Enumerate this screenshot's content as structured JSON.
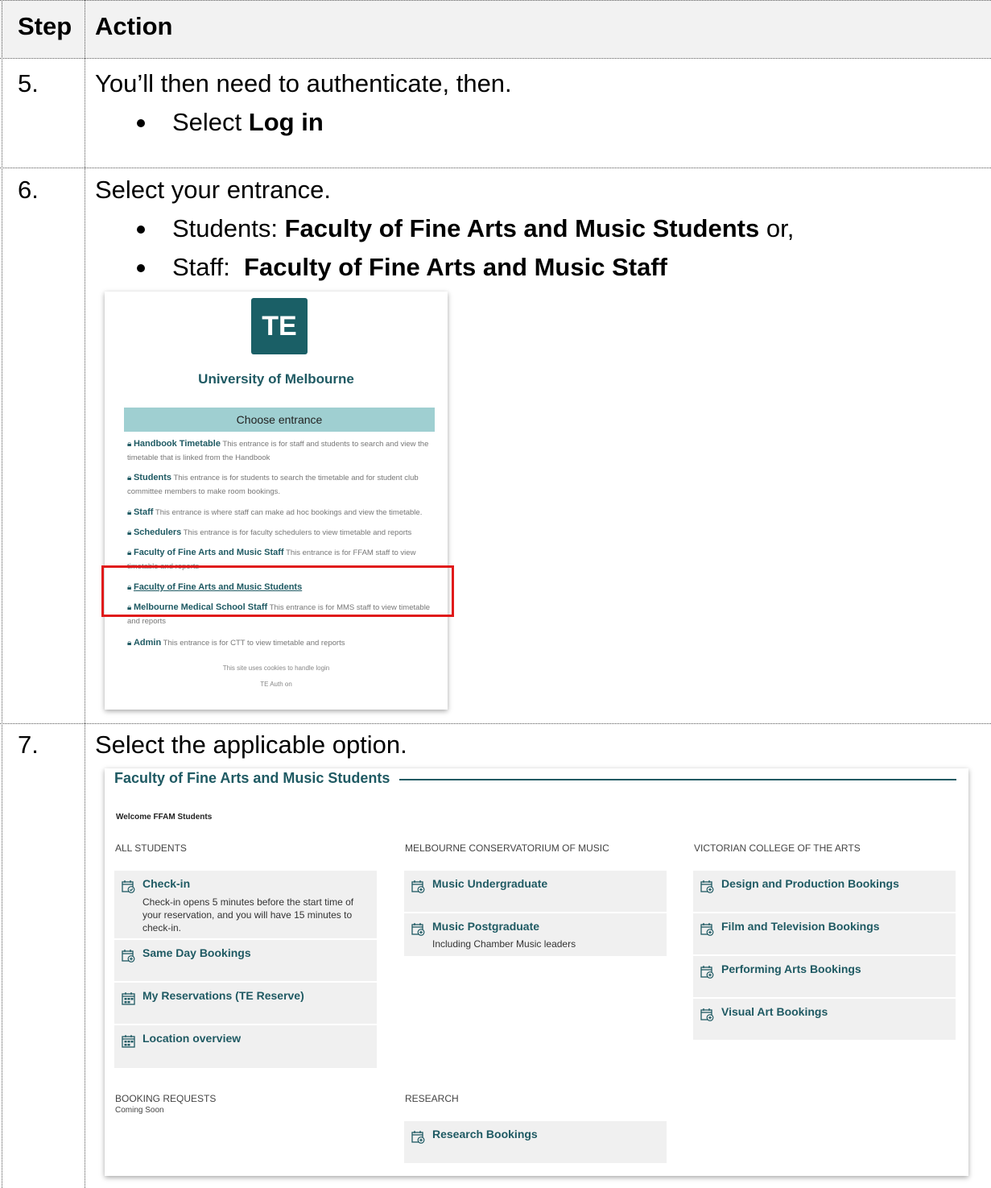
{
  "header": {
    "step": "Step",
    "action": "Action"
  },
  "rows": [
    {
      "num": "5.",
      "text": "You’ll then need to authenticate, then.",
      "bullet_pre": "Select ",
      "bullet_bold": "Log in"
    },
    {
      "num": "6.",
      "text": "Select your entrance.",
      "b1_pre": "Students: ",
      "b1_bold": "Faculty of Fine Arts and Music Students",
      "b1_post": " or,",
      "b2_pre": "Staff:  ",
      "b2_bold": "Faculty of Fine Arts and Music Staff"
    },
    {
      "num": "7.",
      "text": "Select the applicable option."
    }
  ],
  "entrance_screen": {
    "logo": "TE",
    "university": "University of Melbourne",
    "choose": "Choose entrance",
    "entrances": [
      {
        "name": "Handbook Timetable",
        "desc": "This entrance is for staff and students to search and view the timetable that is linked from the Handbook"
      },
      {
        "name": "Students",
        "desc": "This entrance is for students to search the timetable and for student club committee members to make room bookings."
      },
      {
        "name": "Staff",
        "desc": "This entrance is where staff can make ad hoc bookings and view the timetable."
      },
      {
        "name": "Schedulers",
        "desc": "This entrance is for faculty schedulers to view timetable and reports"
      },
      {
        "name": "Faculty of Fine Arts and Music Staff",
        "desc": "This entrance is for FFAM staff to view timetable and reports"
      },
      {
        "name": "Faculty of Fine Arts and Music Students",
        "desc": ""
      },
      {
        "name": "Melbourne Medical School Staff",
        "desc": "This entrance is for MMS staff to view timetable and reports"
      },
      {
        "name": "Admin",
        "desc": "This entrance is for CTT to view timetable and reports"
      }
    ],
    "footer1": "This site uses cookies to handle login",
    "footer2": "TE Auth on"
  },
  "students_screen": {
    "title": "Faculty of Fine Arts and Music Students",
    "welcome": "Welcome FFAM Students",
    "col1": "ALL STUDENTS",
    "col2": "MELBOURNE CONSERVATORIUM OF MUSIC",
    "col3": "VICTORIAN COLLEGE OF THE ARTS",
    "checkin": "Check-in",
    "checkin_desc": "Check-in opens 5 minutes before the start time of your reservation, and you will have 15 minutes to check-in.",
    "same_day": "Same Day Bookings",
    "my_res": "My Reservations (TE Reserve)",
    "location": "Location overview",
    "music_ug": "Music Undergraduate",
    "music_pg": "Music Postgraduate",
    "music_pg_desc": "Including Chamber Music leaders",
    "design": "Design and Production Bookings",
    "film": "Film and Television Bookings",
    "performing": "Performing Arts Bookings",
    "visual": "Visual Art Bookings",
    "booking_requests": "BOOKING REQUESTS",
    "coming_soon": "Coming Soon",
    "research": "RESEARCH",
    "research_bookings": "Research Bookings"
  }
}
